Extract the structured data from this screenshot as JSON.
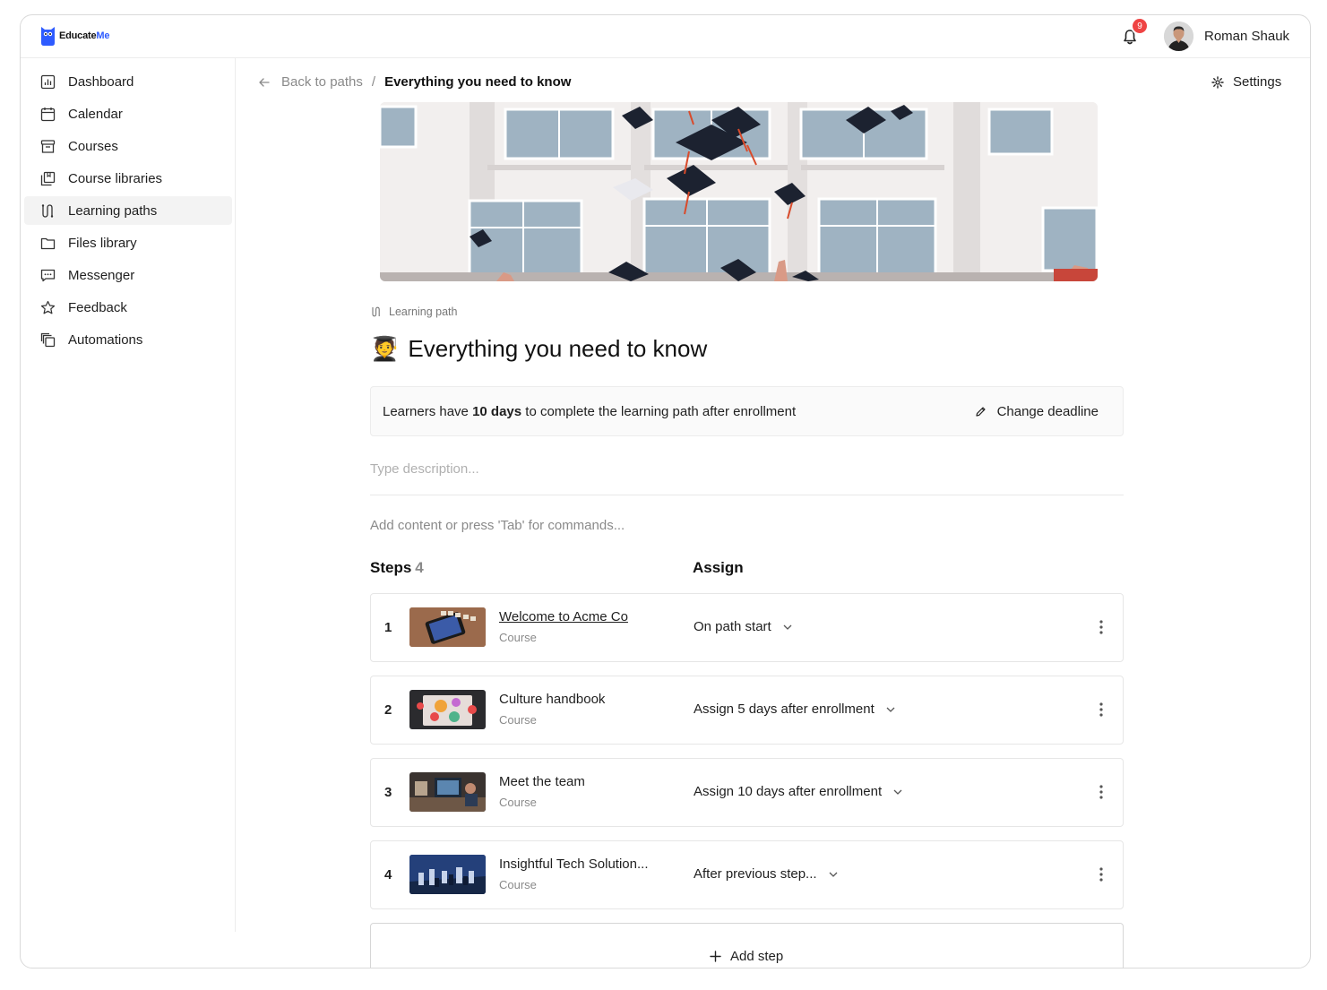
{
  "brand": {
    "name_a": "Educate",
    "name_b": "Me",
    "accent": "#2e5bff"
  },
  "header": {
    "notification_count": "9",
    "user_name": "Roman Shauk"
  },
  "sidebar": {
    "items": [
      {
        "label": "Dashboard",
        "icon": "dashboard-icon"
      },
      {
        "label": "Calendar",
        "icon": "calendar-icon"
      },
      {
        "label": "Courses",
        "icon": "courses-icon"
      },
      {
        "label": "Course libraries",
        "icon": "course-libraries-icon"
      },
      {
        "label": "Learning paths",
        "icon": "learning-paths-icon",
        "active": true
      },
      {
        "label": "Files library",
        "icon": "folder-icon"
      },
      {
        "label": "Messenger",
        "icon": "chat-icon"
      },
      {
        "label": "Feedback",
        "icon": "star-icon"
      },
      {
        "label": "Automations",
        "icon": "automations-icon"
      }
    ]
  },
  "breadcrumb": {
    "back": "Back to paths",
    "separator": "/",
    "current": "Everything you need to know"
  },
  "settings_label": "Settings",
  "path": {
    "kind": "Learning path",
    "emoji": "🧑‍🎓",
    "title": "Everything you need to know",
    "deadline_prefix": "Learners have ",
    "deadline_value": "10 days",
    "deadline_suffix": " to complete the learning path after enrollment",
    "change_deadline": "Change deadline",
    "description_placeholder": "Type description...",
    "add_content_hint": "Add content or press 'Tab' for commands..."
  },
  "steps_header": {
    "label": "Steps",
    "count": "4",
    "assign_label": "Assign"
  },
  "steps": [
    {
      "num": "1",
      "title": "Welcome to Acme Co",
      "type": "Course",
      "assign": "On path start"
    },
    {
      "num": "2",
      "title": "Culture handbook",
      "type": "Course",
      "assign": "Assign 5 days after enrollment"
    },
    {
      "num": "3",
      "title": "Meet the team",
      "type": "Course",
      "assign": "Assign 10 days after enrollment"
    },
    {
      "num": "4",
      "title": "Insightful Tech Solution...",
      "type": "Course",
      "assign": "After previous step..."
    }
  ],
  "add_step_label": "Add step",
  "colors": {
    "badge": "#ef4444",
    "active_nav_bg": "#f3f3f3"
  }
}
